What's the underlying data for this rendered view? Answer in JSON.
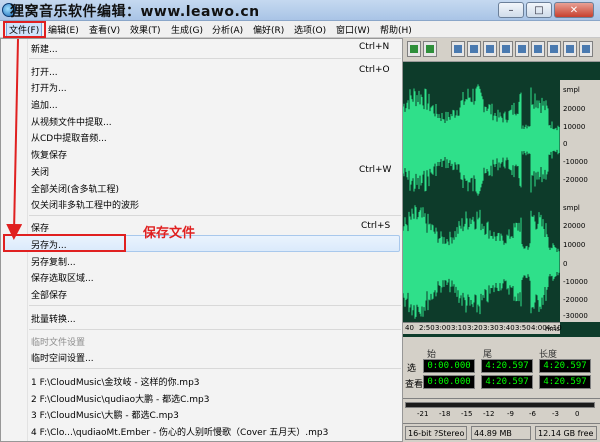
{
  "window": {
    "title": "狸窝音乐软件编辑：www.leawo.cn",
    "minimize_glyph": "–",
    "maximize_glyph": "□",
    "close_glyph": "✕"
  },
  "menubar": {
    "items": [
      {
        "label": "文件(F)"
      },
      {
        "label": "编辑(E)"
      },
      {
        "label": "查看(V)"
      },
      {
        "label": "效果(T)"
      },
      {
        "label": "生成(G)"
      },
      {
        "label": "分析(A)"
      },
      {
        "label": "偏好(R)"
      },
      {
        "label": "选项(O)"
      },
      {
        "label": "窗口(W)"
      },
      {
        "label": "帮助(H)"
      }
    ]
  },
  "file_menu": {
    "items": [
      {
        "label": "新建...",
        "shortcut": "Ctrl+N"
      },
      {
        "label": "打开...",
        "shortcut": "Ctrl+O"
      },
      {
        "label": "打开为..."
      },
      {
        "label": "追加..."
      },
      {
        "label": "从视频文件中提取..."
      },
      {
        "label": "从CD中提取音频..."
      },
      {
        "label": "恢复保存"
      },
      {
        "label": "关闭",
        "shortcut": "Ctrl+W"
      },
      {
        "label": "全部关闭(含多轨工程)"
      },
      {
        "label": "仅关闭非多轨工程中的波形"
      },
      {
        "label": "保存",
        "shortcut": "Ctrl+S"
      },
      {
        "label": "另存为..."
      },
      {
        "label": "另存复制..."
      },
      {
        "label": "保存选取区域..."
      },
      {
        "label": "全部保存"
      },
      {
        "label": "批量转换..."
      },
      {
        "label": "临时文件设置"
      },
      {
        "label": "临时空间设置..."
      },
      {
        "label": "1 F:\\CloudMusic\\金玟岐 - 这样的你.mp3"
      },
      {
        "label": "2 F:\\CloudMusic\\qudiao大鹏 - 都选C.mp3"
      },
      {
        "label": "3 F:\\CloudMusic\\大鹏 - 都选C.mp3"
      },
      {
        "label": "4 F:\\Clo...\\qudiaoMt.Ember - 伤心的人别听慢歌（Cover 五月天）.mp3"
      }
    ]
  },
  "annotation": {
    "label": "保存文件",
    "color": "#e02020"
  },
  "waveform": {
    "right_ruler": [
      "smpl",
      "20000",
      "10000",
      "0",
      "-10000",
      "-20000",
      "smpl",
      "20000",
      "10000",
      "0",
      "-10000",
      "-20000",
      "-30000"
    ],
    "time_ruler": [
      "40",
      "2:50",
      "3:00",
      "3:10",
      "3:20",
      "3:30",
      "3:40",
      "3:50",
      "4:00",
      "4:10"
    ],
    "time_unit": "hms",
    "wave_color": "#2fe08a",
    "background": "#0d3b2a"
  },
  "selection_panel": {
    "headers": [
      "始",
      "尾",
      "长度"
    ],
    "row1_label": "选",
    "row2_label": "查看",
    "row1": [
      "0:00.000",
      "4:20.597",
      "4:20.597"
    ],
    "row2": [
      "0:00.000",
      "4:20.597",
      "4:20.597"
    ]
  },
  "level_meter": {
    "db_labels": [
      "-21",
      "-18",
      "-15",
      "-12",
      "-9",
      "-6",
      "-3",
      "0"
    ]
  },
  "status_bar": {
    "cells": [
      "16-bit ?Stereo",
      "44.89 MB",
      "12.14 GB free"
    ]
  }
}
